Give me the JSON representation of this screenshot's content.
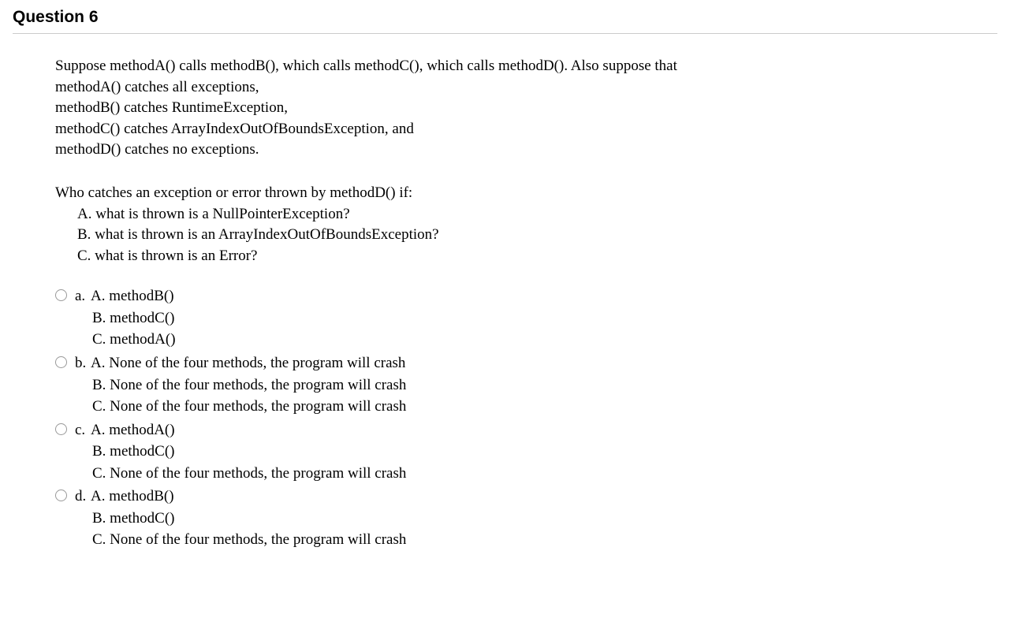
{
  "header": "Question 6",
  "question": {
    "intro_lines": [
      "Suppose methodA() calls methodB(), which calls methodC(), which calls methodD(). Also suppose that",
      "methodA() catches all exceptions,",
      "methodB() catches RuntimeException,",
      "methodC() catches ArrayIndexOutOfBoundsException, and",
      "methodD() catches no exceptions."
    ],
    "prompt": "Who catches an exception or error thrown by methodD() if:",
    "subparts": [
      "A. what is thrown is a NullPointerException?",
      "B. what is thrown is an ArrayIndexOutOfBoundsException?",
      "C. what is thrown is an Error?"
    ]
  },
  "options": [
    {
      "letter": "a.",
      "lines": [
        "A. methodB()",
        "B. methodC()",
        "C. methodA()"
      ]
    },
    {
      "letter": "b.",
      "lines": [
        "A. None of the four methods, the program will crash",
        "B. None of the four methods, the program will crash",
        "C. None of the four methods, the program will crash"
      ]
    },
    {
      "letter": "c.",
      "lines": [
        "A. methodA()",
        "B. methodC()",
        "C. None of the four methods, the program will crash"
      ]
    },
    {
      "letter": "d.",
      "lines": [
        "A. methodB()",
        "B. methodC()",
        "C. None of the four methods, the program will crash"
      ]
    }
  ]
}
